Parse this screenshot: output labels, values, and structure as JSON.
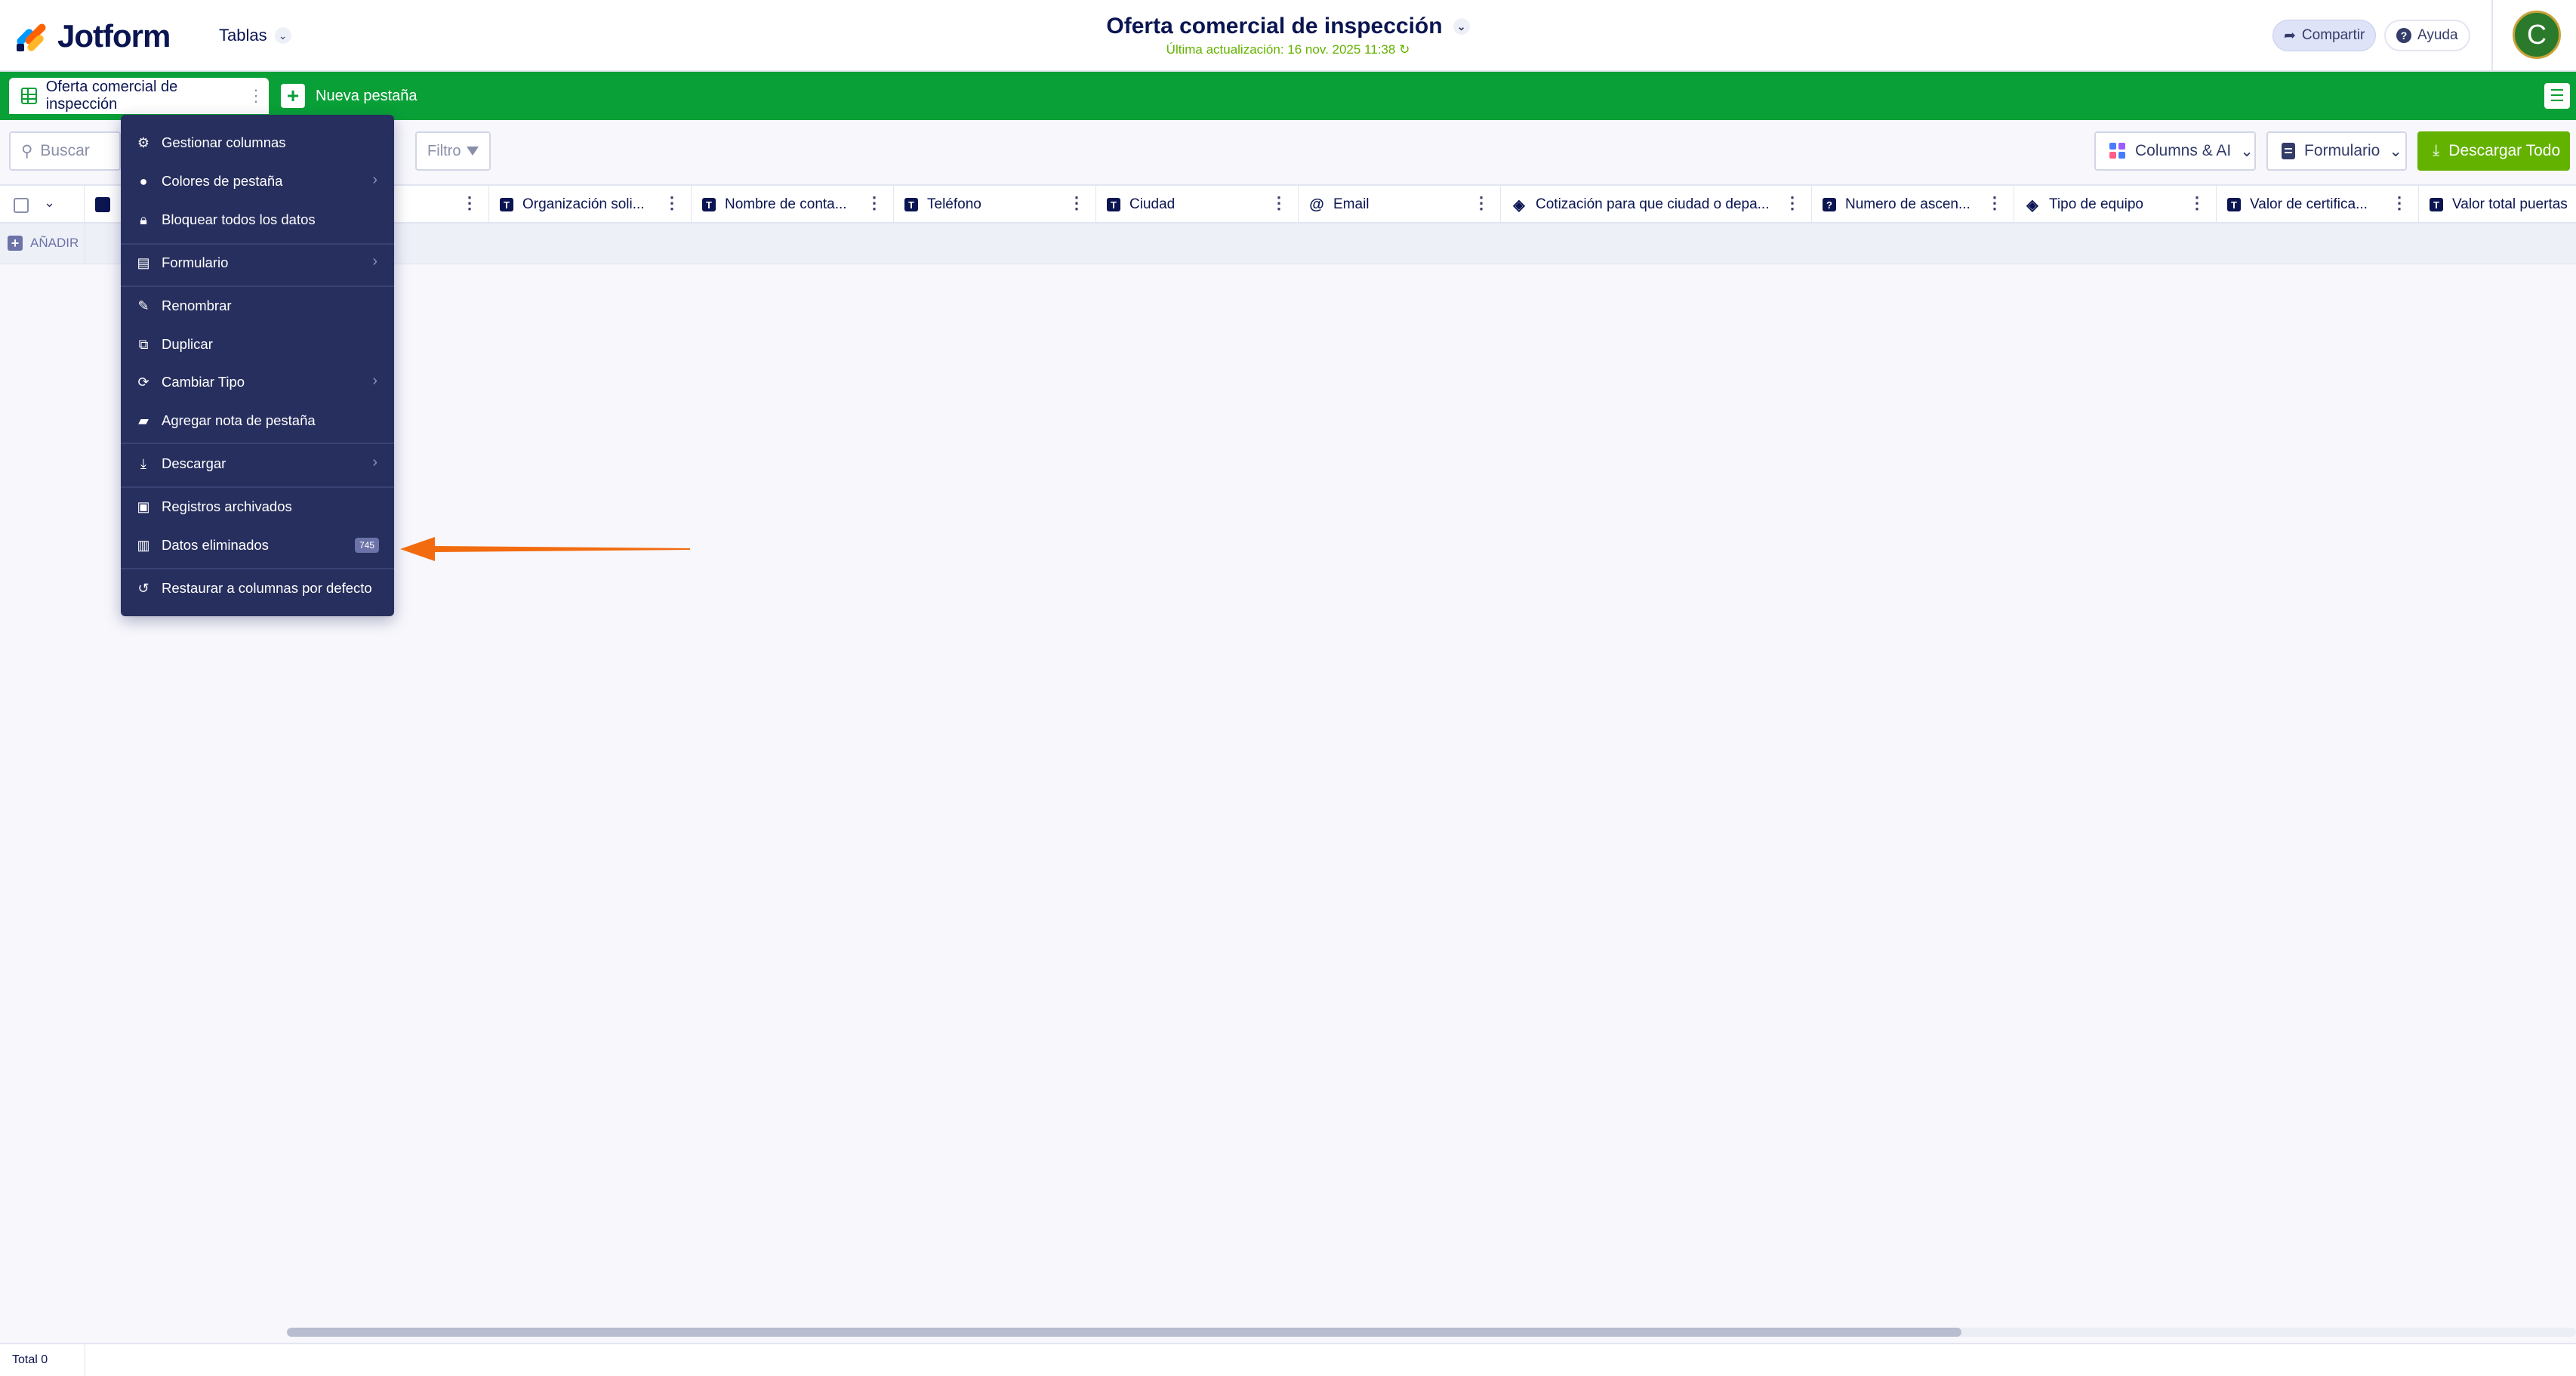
{
  "header": {
    "logo_text": "Jotform",
    "tablas_label": "Tablas",
    "title": "Oferta comercial de inspección",
    "last_update": "Última actualización: 16 nov. 2025 11:38",
    "share_label": "Compartir",
    "help_label": "Ayuda",
    "avatar_initial": "C"
  },
  "tabs": {
    "active_label": "Oferta comercial de inspección",
    "new_tab_label": "Nueva pestaña"
  },
  "toolbar": {
    "search_placeholder": "Buscar",
    "filter_label": "Filtro",
    "columns_ai_label": "Columns & AI",
    "form_label": "Formulario",
    "download_all_label": "Descargar Todo"
  },
  "columns": [
    {
      "label": "Organización soli...",
      "icon": "T"
    },
    {
      "label": "Nombre de conta...",
      "icon": "T"
    },
    {
      "label": "Teléfono",
      "icon": "T"
    },
    {
      "label": "Ciudad",
      "icon": "T"
    },
    {
      "label": "Email",
      "icon": "@"
    },
    {
      "label": "Cotización para que ciudad o depa...",
      "icon": "tag"
    },
    {
      "label": "Numero de ascen...",
      "icon": "?"
    },
    {
      "label": "Tipo de equipo",
      "icon": "tag"
    },
    {
      "label": "Valor de certifica...",
      "icon": "T"
    },
    {
      "label": "Valor total puertas",
      "icon": "T"
    }
  ],
  "add_row_label": "AÑADIR",
  "context_menu": {
    "items": [
      {
        "label": "Gestionar columnas",
        "icon": "gear-icon",
        "has_submenu": false
      },
      {
        "label": "Colores de pestaña",
        "icon": "droplet-icon",
        "has_submenu": true
      },
      {
        "label": "Bloquear todos los datos",
        "icon": "lock-icon",
        "has_submenu": false
      },
      {
        "label": "Formulario",
        "icon": "form-icon",
        "has_submenu": true
      },
      {
        "label": "Renombrar",
        "icon": "rename-icon",
        "has_submenu": false
      },
      {
        "label": "Duplicar",
        "icon": "duplicate-icon",
        "has_submenu": false
      },
      {
        "label": "Cambiar Tipo",
        "icon": "refresh-icon",
        "has_submenu": true
      },
      {
        "label": "Agregar nota de pestaña",
        "icon": "note-icon",
        "has_submenu": false
      },
      {
        "label": "Descargar",
        "icon": "download-icon",
        "has_submenu": true
      },
      {
        "label": "Registros archivados",
        "icon": "archive-icon",
        "has_submenu": false
      },
      {
        "label": "Datos eliminados",
        "icon": "trash-icon",
        "has_submenu": false,
        "badge": "745"
      },
      {
        "label": "Restaurar a columnas por defecto",
        "icon": "restore-icon",
        "has_submenu": false
      }
    ]
  },
  "footer": {
    "total_label": "Total 0"
  },
  "colors": {
    "brand_green": "#09a037",
    "menu_bg": "#272f5e",
    "download_green": "#64b200",
    "arrow_orange": "#f26b0f"
  }
}
